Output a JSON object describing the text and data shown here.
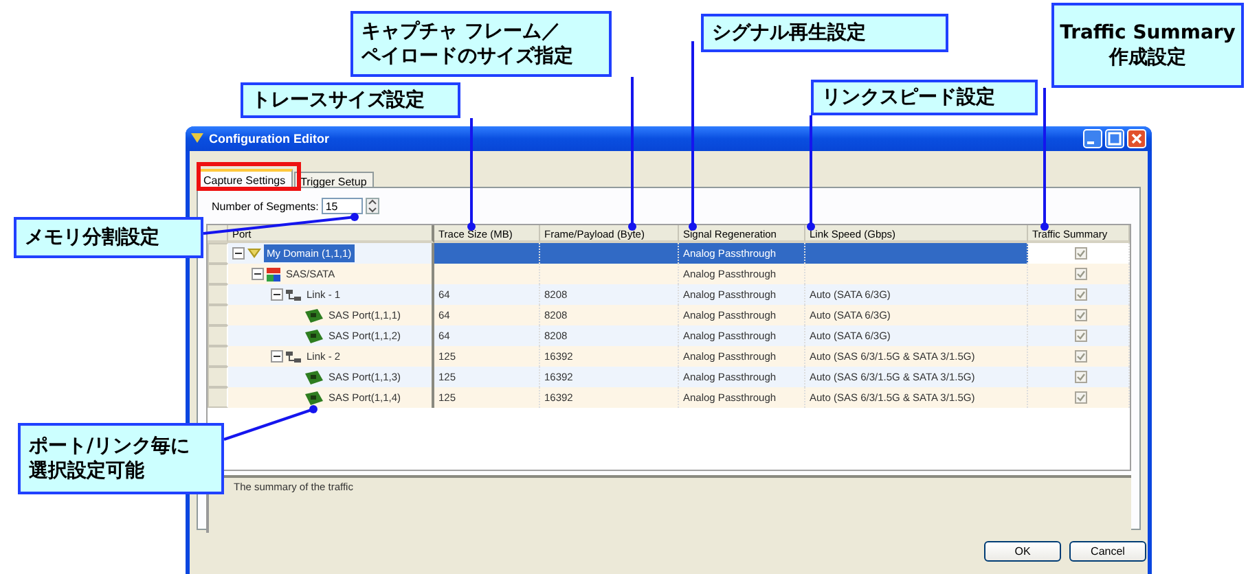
{
  "callouts": [
    {
      "lines": [
        "キャプチャ フレーム／",
        "ペイロードのサイズ指定"
      ]
    },
    {
      "lines": [
        "シグナル再生設定"
      ]
    },
    {
      "lines": [
        "Traffic Summary",
        "作成設定"
      ]
    },
    {
      "lines": [
        "トレースサイズ設定"
      ]
    },
    {
      "lines": [
        "リンクスピード設定"
      ]
    },
    {
      "lines": [
        "メモリ分割設定"
      ]
    },
    {
      "lines": [
        "ポート/リンク毎に",
        "選択設定可能"
      ]
    }
  ],
  "window": {
    "title": "Configuration Editor",
    "tabs": [
      {
        "label": "Capture Settings",
        "selected": true
      },
      {
        "label": "Trigger Setup",
        "selected": false
      }
    ],
    "segments": {
      "label": "Number of Segments:",
      "value": "15"
    },
    "table": {
      "columns": [
        "Port",
        "Trace Size (MB)",
        "Frame/Payload (Byte)",
        "Signal Regeneration",
        "Link Speed (Gbps)",
        "Traffic Summary"
      ],
      "rows": [
        {
          "kind": "domain",
          "name": "My Domain (1,1,1)",
          "selected": true,
          "expanded": true,
          "signal": "Analog Passthrough",
          "summary_checked": true,
          "children": [
            {
              "kind": "bus",
              "name": "SAS/SATA",
              "selected": false,
              "expanded": true,
              "signal": "Analog Passthrough",
              "summary_checked": true,
              "children": [
                {
                  "kind": "link",
                  "name": "Link - 1",
                  "selected": false,
                  "expanded": true,
                  "trace": "64",
                  "frame": "8208",
                  "signal": "Analog Passthrough",
                  "speed": "Auto (SATA 6/3G)",
                  "summary_checked": true,
                  "children": [
                    {
                      "kind": "port",
                      "name": "SAS Port(1,1,1)",
                      "selected": false,
                      "trace": "64",
                      "frame": "8208",
                      "signal": "Analog Passthrough",
                      "speed": "Auto (SATA 6/3G)",
                      "summary_checked": true
                    },
                    {
                      "kind": "port",
                      "name": "SAS Port(1,1,2)",
                      "selected": false,
                      "trace": "64",
                      "frame": "8208",
                      "signal": "Analog Passthrough",
                      "speed": "Auto (SATA 6/3G)",
                      "summary_checked": true
                    }
                  ]
                },
                {
                  "kind": "link",
                  "name": "Link - 2",
                  "selected": false,
                  "expanded": true,
                  "trace": "125",
                  "frame": "16392",
                  "signal": "Analog Passthrough",
                  "speed": "Auto (SAS 6/3/1.5G & SATA 3/1.5G)",
                  "summary_checked": true,
                  "children": [
                    {
                      "kind": "port",
                      "name": "SAS Port(1,1,3)",
                      "selected": false,
                      "trace": "125",
                      "frame": "16392",
                      "signal": "Analog Passthrough",
                      "speed": "Auto (SAS 6/3/1.5G & SATA 3/1.5G)",
                      "summary_checked": true
                    },
                    {
                      "kind": "port",
                      "name": "SAS Port(1,1,4)",
                      "selected": false,
                      "trace": "125",
                      "frame": "16392",
                      "signal": "Analog Passthrough",
                      "speed": "Auto (SAS 6/3/1.5G & SATA 3/1.5G)",
                      "summary_checked": true
                    }
                  ]
                }
              ]
            }
          ]
        }
      ]
    },
    "description": "The summary of the traffic",
    "buttons": [
      "OK",
      "Cancel"
    ]
  }
}
